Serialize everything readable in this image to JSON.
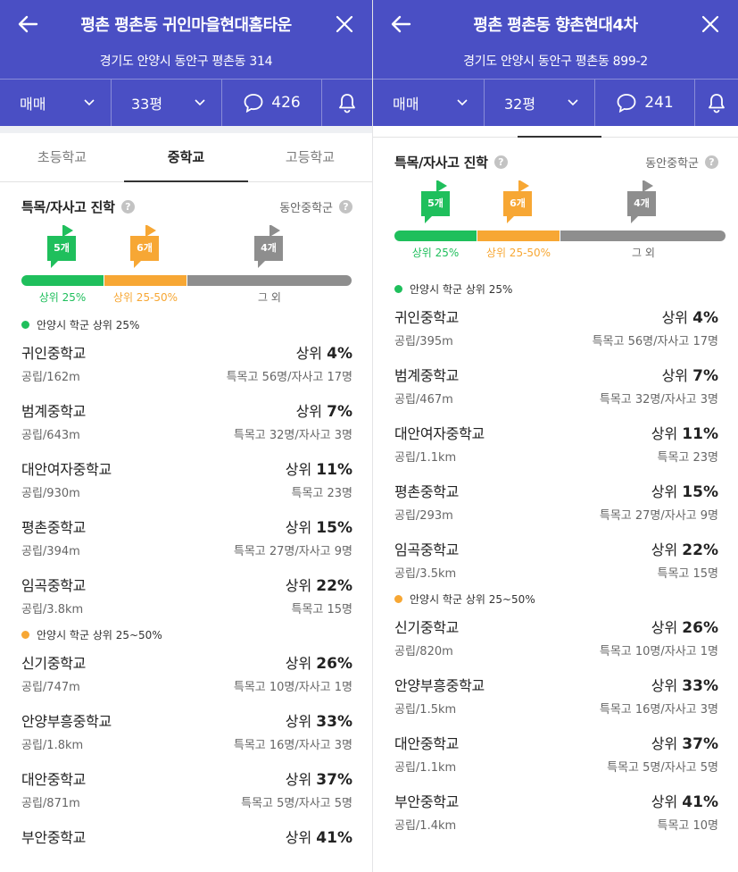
{
  "theme": {
    "header_bg": "#4a4fc4",
    "green": "#1fbf5c",
    "orange": "#f7a734",
    "gray": "#8e8e8e"
  },
  "panels": [
    {
      "header": {
        "title": "평촌 평촌동 귀인마을현대홈타운",
        "address": "경기도 안양시 동안구 평촌동 314",
        "deal_type": "매매",
        "size": "33평",
        "comment_count": "426"
      },
      "tabs": [
        {
          "label": "초등학교"
        },
        {
          "label": "중학교"
        },
        {
          "label": "고등학교"
        }
      ],
      "section": {
        "title": "특목/자사고 진학",
        "district": "동안중학군"
      },
      "flags": [
        {
          "label": "5개"
        },
        {
          "label": "6개"
        },
        {
          "label": "4개"
        }
      ],
      "bar_labels": [
        "상위 25%",
        "상위 25-50%",
        "그 외"
      ],
      "groups": [
        {
          "title": "안양시 학군 상위 25%",
          "schools": [
            {
              "name": "귀인중학교",
              "rank_prefix": "상위",
              "rank": "4%",
              "type_dist": "공립/162m",
              "stats": "특목고 56명/자사고 17명"
            },
            {
              "name": "범계중학교",
              "rank_prefix": "상위",
              "rank": "7%",
              "type_dist": "공립/643m",
              "stats": "특목고 32명/자사고 3명"
            },
            {
              "name": "대안여자중학교",
              "rank_prefix": "상위",
              "rank": "11%",
              "type_dist": "공립/930m",
              "stats": "특목고 23명"
            },
            {
              "name": "평촌중학교",
              "rank_prefix": "상위",
              "rank": "15%",
              "type_dist": "공립/394m",
              "stats": "특목고 27명/자사고 9명"
            },
            {
              "name": "임곡중학교",
              "rank_prefix": "상위",
              "rank": "22%",
              "type_dist": "공립/3.8km",
              "stats": "특목고 15명"
            }
          ]
        },
        {
          "title": "안양시 학군 상위 25~50%",
          "schools": [
            {
              "name": "신기중학교",
              "rank_prefix": "상위",
              "rank": "26%",
              "type_dist": "공립/747m",
              "stats": "특목고 10명/자사고 1명"
            },
            {
              "name": "안양부흥중학교",
              "rank_prefix": "상위",
              "rank": "33%",
              "type_dist": "공립/1.8km",
              "stats": "특목고 16명/자사고 3명"
            },
            {
              "name": "대안중학교",
              "rank_prefix": "상위",
              "rank": "37%",
              "type_dist": "공립/871m",
              "stats": "특목고 5명/자사고 5명"
            },
            {
              "name": "부안중학교",
              "rank_prefix": "상위",
              "rank": "41%",
              "type_dist": "",
              "stats": ""
            }
          ]
        }
      ]
    },
    {
      "header": {
        "title": "평촌 평촌동 향촌현대4차",
        "address": "경기도 안양시 동안구 평촌동 899-2",
        "deal_type": "매매",
        "size": "32평",
        "comment_count": "241"
      },
      "section": {
        "title": "특목/자사고 진학",
        "district": "동안중학군"
      },
      "flags": [
        {
          "label": "5개"
        },
        {
          "label": "6개"
        },
        {
          "label": "4개"
        }
      ],
      "bar_labels": [
        "상위 25%",
        "상위 25-50%",
        "그 외"
      ],
      "groups": [
        {
          "title": "안양시 학군 상위 25%",
          "schools": [
            {
              "name": "귀인중학교",
              "rank_prefix": "상위",
              "rank": "4%",
              "type_dist": "공립/395m",
              "stats": "특목고 56명/자사고 17명"
            },
            {
              "name": "범계중학교",
              "rank_prefix": "상위",
              "rank": "7%",
              "type_dist": "공립/467m",
              "stats": "특목고 32명/자사고 3명"
            },
            {
              "name": "대안여자중학교",
              "rank_prefix": "상위",
              "rank": "11%",
              "type_dist": "공립/1.1km",
              "stats": "특목고 23명"
            },
            {
              "name": "평촌중학교",
              "rank_prefix": "상위",
              "rank": "15%",
              "type_dist": "공립/293m",
              "stats": "특목고 27명/자사고 9명"
            },
            {
              "name": "임곡중학교",
              "rank_prefix": "상위",
              "rank": "22%",
              "type_dist": "공립/3.5km",
              "stats": "특목고 15명"
            }
          ]
        },
        {
          "title": "안양시 학군 상위 25~50%",
          "schools": [
            {
              "name": "신기중학교",
              "rank_prefix": "상위",
              "rank": "26%",
              "type_dist": "공립/820m",
              "stats": "특목고 10명/자사고 1명"
            },
            {
              "name": "안양부흥중학교",
              "rank_prefix": "상위",
              "rank": "33%",
              "type_dist": "공립/1.5km",
              "stats": "특목고 16명/자사고 3명"
            },
            {
              "name": "대안중학교",
              "rank_prefix": "상위",
              "rank": "37%",
              "type_dist": "공립/1.1km",
              "stats": "특목고 5명/자사고 5명"
            },
            {
              "name": "부안중학교",
              "rank_prefix": "상위",
              "rank": "41%",
              "type_dist": "공립/1.4km",
              "stats": "특목고 10명"
            }
          ]
        }
      ]
    }
  ]
}
